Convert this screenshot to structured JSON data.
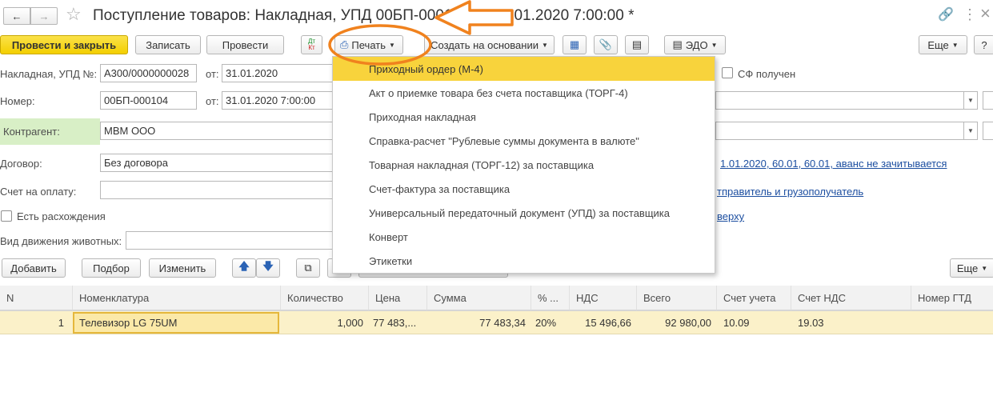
{
  "window": {
    "title": "Поступление товаров: Накладная, УПД 00БП-000104 от 31.01.2020 7:00:00 *",
    "more_dots": "⋮",
    "close": "×"
  },
  "toolbar": {
    "post_close": "Провести и закрыть",
    "save": "Записать",
    "post": "Провести",
    "dt_kt": "Дт/Кт",
    "print": "Печать",
    "create_based": "Создать на основании",
    "edo": "ЭДО",
    "more": "Еще",
    "help": "?"
  },
  "form": {
    "invoice_label": "Накладная, УПД №:",
    "invoice_value": "А300/0000000028",
    "from_label1": "от:",
    "date1": "31.01.2020",
    "sf_label": "СФ получен",
    "number_label": "Номер:",
    "number_value": "00БП-000104",
    "from_label2": "от:",
    "date2": "31.01.2020  7:00:00",
    "counterparty_label": "Контрагент:",
    "counterparty_value": "МВМ ООО",
    "contract_label": "Договор:",
    "contract_value": "Без договора",
    "contract_link": "1.01.2020, 60.01, 60.01, аванс не зачитывается",
    "invoice_pay_label": "Счет на оплату:",
    "shipper_link": "тправитель и грузополучатель",
    "discrepancy_label": "Есть расхождения",
    "top_link": "верху",
    "animal_label": "Вид движения животных:"
  },
  "table_toolbar": {
    "add": "Добавить",
    "select": "Подбор",
    "change": "Изменить",
    "more": "Еще"
  },
  "table": {
    "columns": [
      "N",
      "Номенклатура",
      "Количество",
      "Цена",
      "Сумма",
      "% ...",
      "НДС",
      "Всего",
      "Счет учета",
      "Счет НДС",
      "Номер ГТД"
    ],
    "rows": [
      [
        "1",
        "Телевизор LG 75UM",
        "1,000",
        "77 483,...",
        "77 483,34",
        "20%",
        "15 496,66",
        "92 980,00",
        "10.09",
        "19.03",
        ""
      ]
    ]
  },
  "print_menu": {
    "items": [
      "Приходный ордер (М-4)",
      "Акт о приемке товара без счета поставщика (ТОРГ-4)",
      "Приходная накладная",
      "Справка-расчет \"Рублевые суммы документа в валюте\"",
      "Товарная накладная (ТОРГ-12) за поставщика",
      "Счет-фактура за поставщика",
      "Универсальный передаточный документ (УПД) за поставщика",
      "Конверт",
      "Этикетки"
    ],
    "selected_index": 0
  },
  "colors": {
    "accent_yellow": "#f8d33c",
    "annotation_orange": "#f0821e",
    "counterparty_bg": "#d8efc6",
    "link_blue": "#1c4ea0"
  }
}
